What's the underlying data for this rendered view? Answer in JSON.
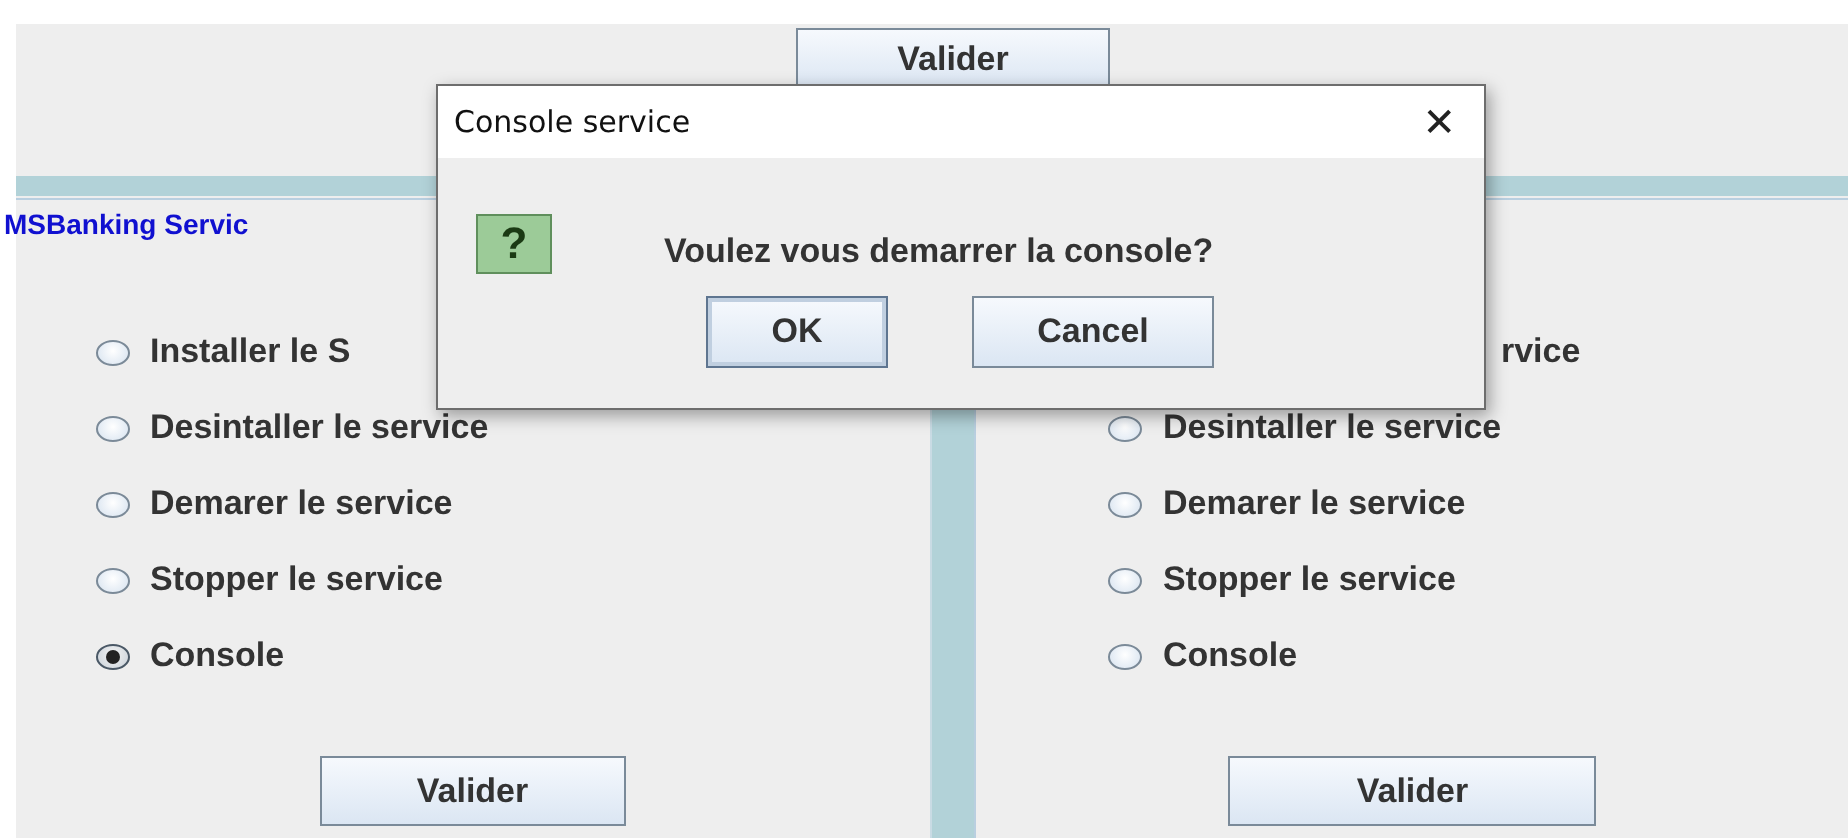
{
  "top_button": "Valider",
  "panels": [
    {
      "title": "MSBanking Servic",
      "options": [
        {
          "label": "Installer le S",
          "selected": false,
          "covered": false
        },
        {
          "label": "Desintaller le service",
          "selected": false,
          "covered": false
        },
        {
          "label": "Demarer le service",
          "selected": false,
          "covered": false
        },
        {
          "label": "Stopper le service",
          "selected": false,
          "covered": false
        },
        {
          "label": "Console",
          "selected": true,
          "covered": false
        }
      ],
      "button": "Valider"
    },
    {
      "options": [
        {
          "label": "rvice",
          "covered": true
        },
        {
          "label": "Desintaller le service",
          "selected": false,
          "covered": false
        },
        {
          "label": "Demarer le service",
          "selected": false,
          "covered": false
        },
        {
          "label": "Stopper le service",
          "selected": false,
          "covered": false
        },
        {
          "label": "Console",
          "selected": false,
          "covered": false
        }
      ],
      "button": "Valider"
    }
  ],
  "dialog": {
    "title": "Console service",
    "close": "✕",
    "icon": "?",
    "message": "Voulez vous demarrer la console?",
    "buttons": [
      {
        "label": "OK",
        "focused": true
      },
      {
        "label": "Cancel",
        "focused": false
      }
    ]
  }
}
